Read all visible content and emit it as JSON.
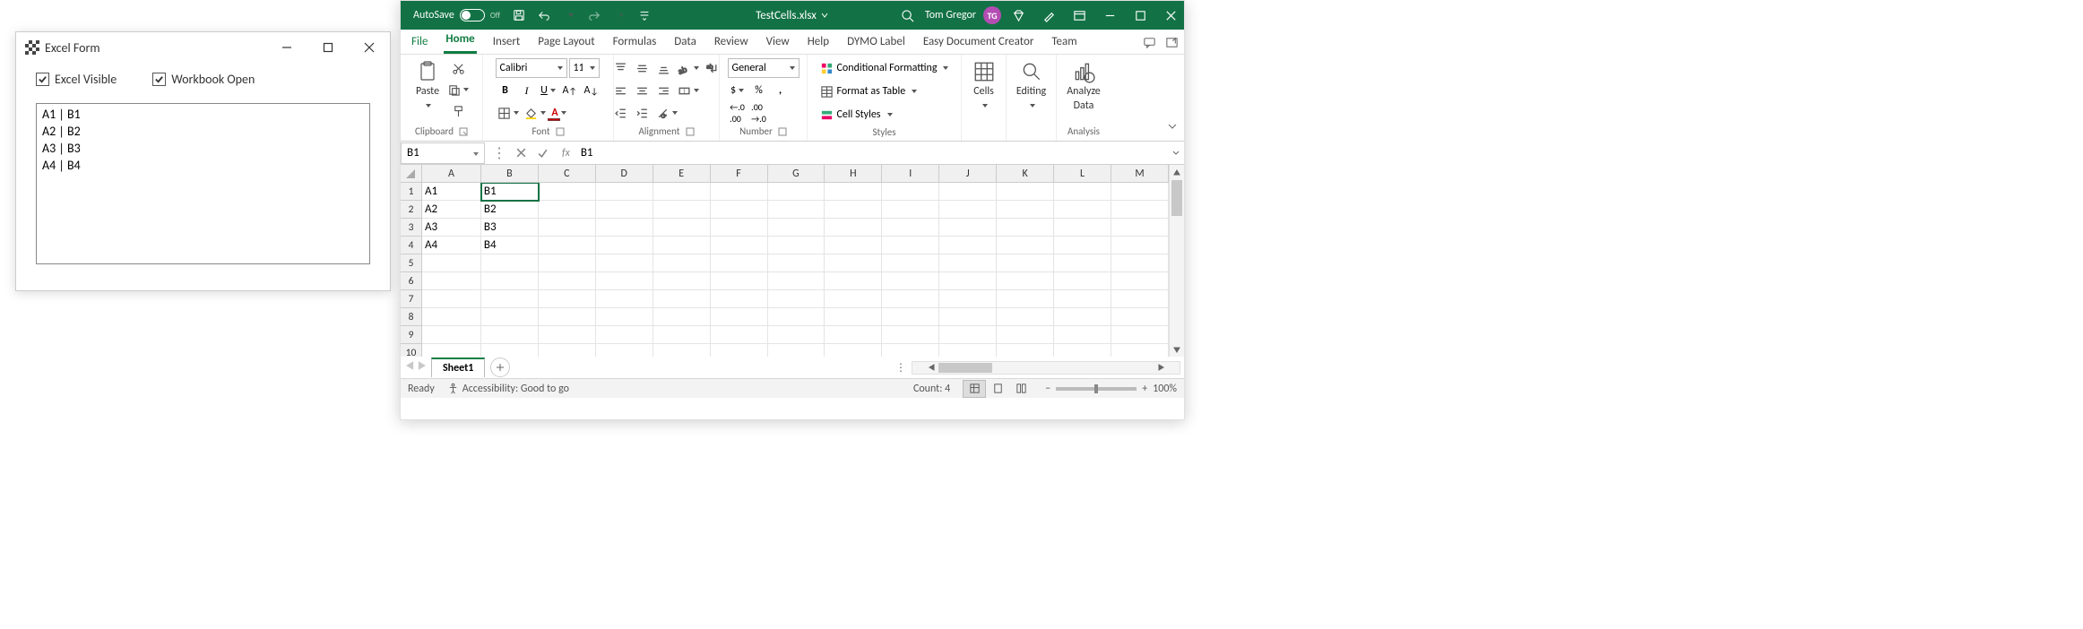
{
  "form": {
    "title": "Excel Form",
    "check1": "Excel Visible",
    "check2": "Workbook Open",
    "list": [
      "A1 | B1",
      "A2 | B2",
      "A3 | B3",
      "A4 | B4"
    ]
  },
  "excel": {
    "autosave_label": "AutoSave",
    "autosave_state": "Off",
    "filename": "TestCells.xlsx",
    "user": "Tom Gregor",
    "user_initials": "TG",
    "tabs": [
      "File",
      "Home",
      "Insert",
      "Page Layout",
      "Formulas",
      "Data",
      "Review",
      "View",
      "Help",
      "DYMO Label",
      "Easy Document Creator",
      "Team"
    ],
    "active_tab": "Home",
    "groups": {
      "clipboard": "Clipboard",
      "paste": "Paste",
      "font": "Font",
      "alignment": "Alignment",
      "number": "Number",
      "styles": "Styles",
      "cells": "Cells",
      "editing": "Editing",
      "analysis": "Analysis",
      "analyze_top": "Analyze",
      "analyze_bot": "Data"
    },
    "font_name": "Calibri",
    "font_size": "11",
    "number_format": "General",
    "cond_fmt": "Conditional Formatting",
    "fmt_table": "Format as Table",
    "cell_styles": "Cell Styles",
    "namebox": "B1",
    "formula": "B1",
    "columns": [
      "A",
      "B",
      "C",
      "D",
      "E",
      "F",
      "G",
      "H",
      "I",
      "J",
      "K",
      "L",
      "M"
    ],
    "rows": [
      {
        "n": "1",
        "cells": [
          "A1",
          "B1"
        ]
      },
      {
        "n": "2",
        "cells": [
          "A2",
          "B2"
        ]
      },
      {
        "n": "3",
        "cells": [
          "A3",
          "B3"
        ]
      },
      {
        "n": "4",
        "cells": [
          "A4",
          "B4"
        ]
      },
      {
        "n": "5",
        "cells": []
      },
      {
        "n": "6",
        "cells": []
      },
      {
        "n": "7",
        "cells": []
      },
      {
        "n": "8",
        "cells": []
      },
      {
        "n": "9",
        "cells": []
      },
      {
        "n": "10",
        "cells": []
      }
    ],
    "selected_cell": {
      "row": 0,
      "col": 1
    },
    "sheet": "Sheet1",
    "status_ready": "Ready",
    "status_acc": "Accessibility: Good to go",
    "status_count": "Count: 4",
    "zoom": "100%"
  }
}
